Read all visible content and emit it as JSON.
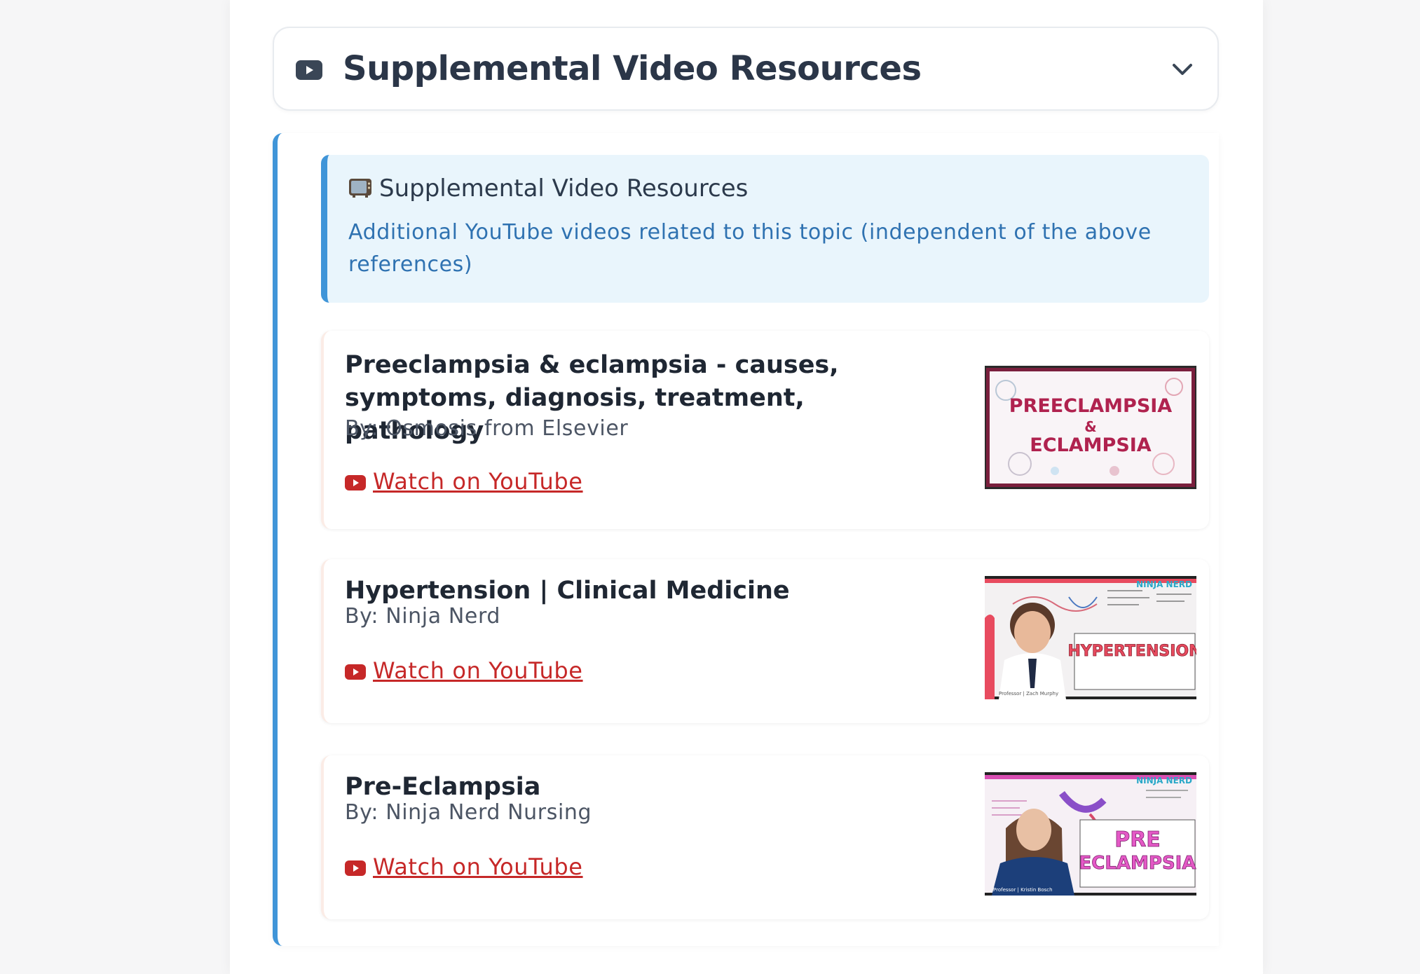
{
  "accordion": {
    "title": "Supplemental Video Resources",
    "icon": "youtube-icon",
    "toggle_icon": "chevron-down-icon"
  },
  "info_box": {
    "icon": "tv-icon",
    "title": "Supplemental Video Resources",
    "description": "Additional YouTube videos related to this topic (independent of the above references)"
  },
  "videos": [
    {
      "title": "Preeclampsia & eclampsia - causes, symptoms, diagnosis, treatment, pathology",
      "by": "By: Osmosis from Elsevier",
      "link_label": "Watch on YouTube",
      "thumbnail_text": [
        "PREECLAMPSIA",
        "&",
        "ECLAMPSIA"
      ]
    },
    {
      "title": "Hypertension | Clinical Medicine",
      "by": "By: Ninja Nerd",
      "link_label": "Watch on YouTube",
      "thumbnail_text": [
        "HYPERTENSION"
      ],
      "thumbnail_brand": "NINJA NERD"
    },
    {
      "title": "Pre-Eclampsia",
      "by": "By: Ninja Nerd Nursing",
      "link_label": "Watch on YouTube",
      "thumbnail_text": [
        "PRE",
        "ECLAMPSIA"
      ],
      "thumbnail_brand": "NINJA NERD"
    }
  ],
  "colors": {
    "accent_blue": "#4095d8",
    "info_bg": "#e9f5fc",
    "link_red": "#c62828",
    "title_dark": "#2b3648"
  }
}
